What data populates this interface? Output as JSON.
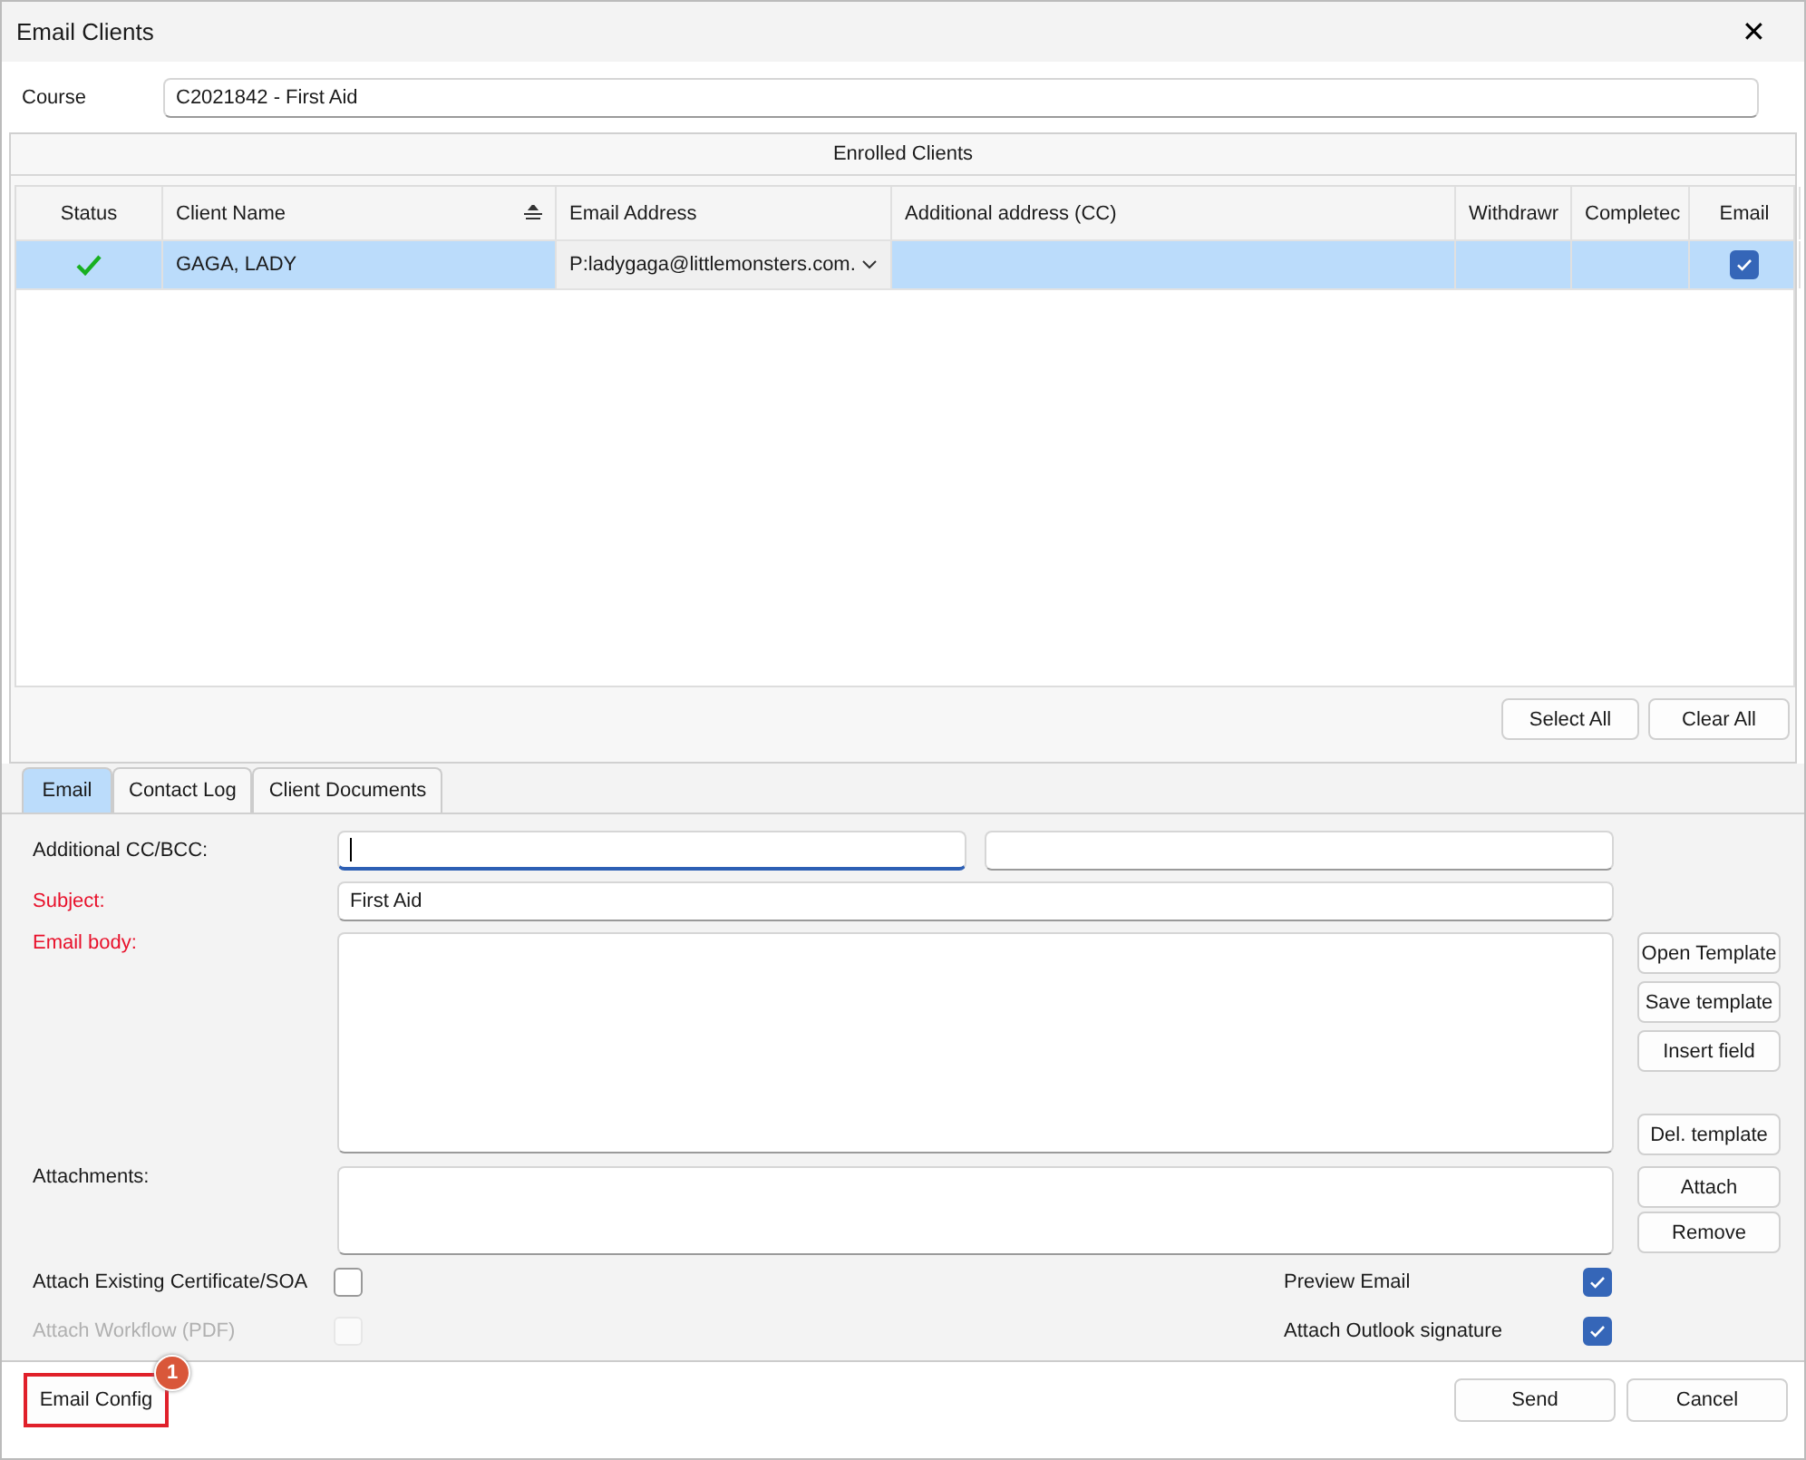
{
  "window": {
    "title": "Email Clients",
    "close": "✕"
  },
  "course": {
    "label": "Course",
    "value": "C2021842 - First Aid"
  },
  "enrolled": {
    "title": "Enrolled Clients",
    "columns": [
      {
        "label": "Status",
        "sorted": false
      },
      {
        "label": "Client Name",
        "sorted": true
      },
      {
        "label": "Email Address",
        "sorted": false
      },
      {
        "label": "Additional address (CC)",
        "sorted": false
      },
      {
        "label": "Withdrawr",
        "sorted": false
      },
      {
        "label": "Completec",
        "sorted": false
      },
      {
        "label": "Email",
        "sorted": false
      }
    ],
    "rows": [
      {
        "selected": true,
        "status_ok": true,
        "name": "GAGA, LADY",
        "email": "P:ladygaga@littlemonsters.com.",
        "cc": "",
        "withdrawn": "",
        "completed": "",
        "email_checked": true
      }
    ],
    "buttons": [
      "Select All",
      "Clear All"
    ]
  },
  "tabs": [
    {
      "label": "Email",
      "selected": true
    },
    {
      "label": "Contact Log",
      "selected": false
    },
    {
      "label": "Client Documents",
      "selected": false
    }
  ],
  "form": {
    "cc_label": "Additional CC/BCC:",
    "subject_label": "Subject:",
    "subject": "First Aid",
    "body_label": "Email body:",
    "attachments_label": "Attachments:",
    "template_buttons": [
      "Open Template",
      "Save template",
      "Insert field"
    ],
    "delete_button": "Del. template",
    "attach_buttons": [
      "Attach",
      "Remove"
    ],
    "left_options": [
      {
        "label": "Attach Existing Certificate/SOA",
        "checked": false,
        "disabled": false
      },
      {
        "label": "Attach Workflow (PDF)",
        "checked": false,
        "disabled": true
      }
    ],
    "right_options": [
      {
        "label": "Preview Email",
        "checked": true,
        "disabled": false
      },
      {
        "label": "Attach Outlook signature",
        "checked": true,
        "disabled": false
      }
    ]
  },
  "footer": {
    "config_button": {
      "label": "Email Config",
      "highlighted": true,
      "badge": "1"
    },
    "buttons": [
      "Send",
      "Cancel"
    ]
  }
}
